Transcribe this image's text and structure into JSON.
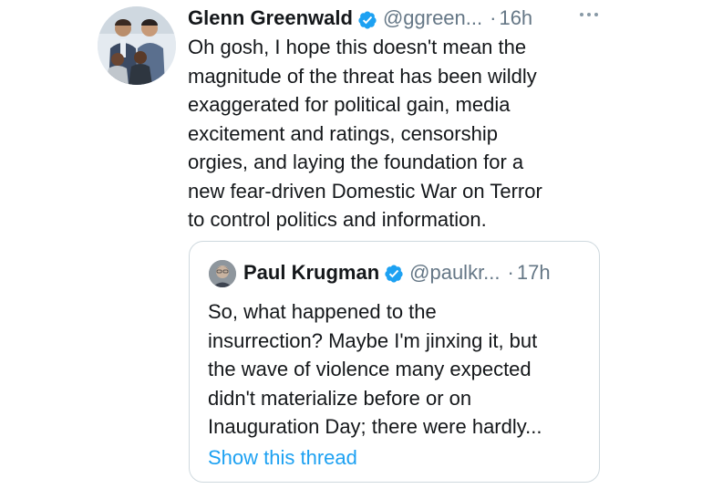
{
  "tweet": {
    "author_name": "Glenn Greenwald",
    "handle": "@ggreen...",
    "separator": "·",
    "time": "16h",
    "more_icon": "ellipsis-icon",
    "verified_icon": "verified-badge-icon",
    "lines": [
      "Oh gosh, I hope this doesn't mean the",
      "magnitude of the threat has been wildly",
      "exaggerated for political gain, media",
      "excitement and ratings, censorship",
      "orgies, and laying the foundation for a",
      "new fear-driven Domestic War on Terror",
      "to control politics and information."
    ]
  },
  "quoted_tweet": {
    "author_name": "Paul Krugman",
    "handle": "@paulkr...",
    "separator": "·",
    "time": "17h",
    "verified_icon": "verified-badge-icon",
    "lines": [
      "So, what happened to the",
      "insurrection? Maybe I'm jinxing it, but",
      "the wave of violence many expected",
      "didn't materialize before or on",
      "Inauguration Day; there were hardly..."
    ],
    "show_thread_label": "Show this thread"
  },
  "colors": {
    "text": "#14171a",
    "secondary": "#657786",
    "link": "#1da1f2",
    "verified": "#1da1f2",
    "border": "#cfd9de"
  }
}
